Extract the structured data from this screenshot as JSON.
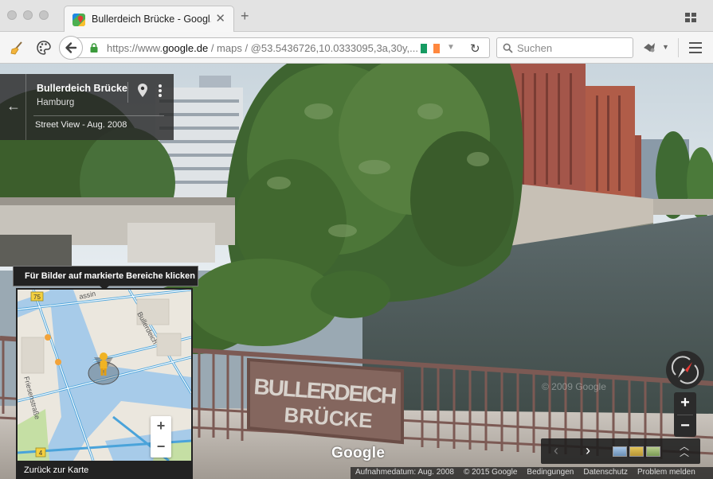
{
  "browser": {
    "tab": {
      "title": "Bullerdeich Brücke - Googl..."
    },
    "address": {
      "scheme": "https://www.",
      "host": "google.de",
      "path": " / maps / @53.5436726,10.0333095,3a,30y,..."
    },
    "search": {
      "placeholder": "Suchen"
    },
    "flag_colors": [
      "#169b62",
      "#ffffff",
      "#ff883e"
    ]
  },
  "streetview": {
    "place": {
      "name": "Bullerdeich Brücke",
      "city": "Hamburg",
      "date": "Street View - Aug. 2008"
    },
    "tooltip": "Für Bilder auf markierte Bereiche klicken",
    "minimap": {
      "back_label": "Zurück zur Karte",
      "street_labels": [
        "Bullerdeich",
        "Friesenstraße",
        "assin"
      ],
      "route_badges": [
        "75",
        "4"
      ],
      "zoom_in": "+",
      "zoom_out": "−"
    },
    "controls": {
      "zoom_in": "+",
      "zoom_out": "−"
    },
    "filmstrip": {
      "prev": "‹",
      "next": "›"
    },
    "sign": {
      "line1": "BULLERDEICH",
      "line2": "BRÜCKE"
    },
    "watermark": "Google",
    "image_watermark": "© 2009 Google",
    "attribution": [
      "Aufnahmedatum: Aug. 2008",
      "© 2015 Google",
      "Bedingungen",
      "Datenschutz",
      "Problem melden"
    ]
  }
}
